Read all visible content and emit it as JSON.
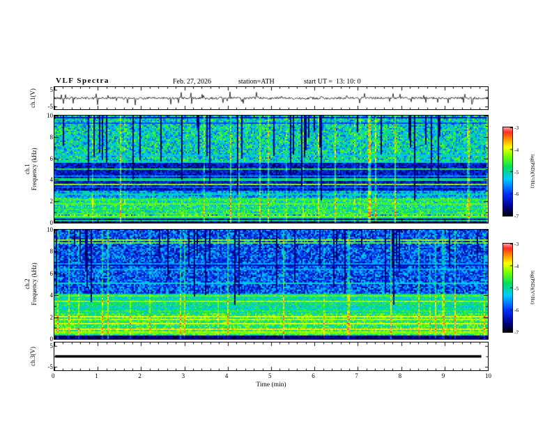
{
  "title": "VLF Spectra",
  "header": {
    "date": "Feb. 27, 2026",
    "station": "station=ATH",
    "start_ut": "start UT =  13: 10: 0"
  },
  "xaxis": {
    "label": "Time (min)",
    "range": [
      0,
      10
    ],
    "ticks": [
      0,
      1,
      2,
      3,
      4,
      5,
      6,
      7,
      8,
      9,
      10
    ]
  },
  "colorbar": {
    "label": "log(PSD)(V²/Hz)",
    "range": [
      -7,
      -3
    ],
    "ticks": [
      -3,
      -4,
      -5,
      -6,
      -7
    ],
    "stops": [
      [
        0.0,
        "#000000"
      ],
      [
        0.1,
        "#000080"
      ],
      [
        0.25,
        "#0030ff"
      ],
      [
        0.42,
        "#00ccff"
      ],
      [
        0.55,
        "#00dd66"
      ],
      [
        0.68,
        "#7aff00"
      ],
      [
        0.78,
        "#ffff00"
      ],
      [
        0.88,
        "#ff8800"
      ],
      [
        0.95,
        "#ff2a2a"
      ],
      [
        1.0,
        "#ff9999"
      ]
    ]
  },
  "chart_data": [
    {
      "type": "line",
      "name": "ch1-waveform",
      "ylabel": "ch.1(V)",
      "ylim": [
        -5,
        5
      ],
      "yticks": [
        5,
        -5
      ],
      "yscale_v": 6.5,
      "seed": 42,
      "noise_amp_v": 0.7,
      "spike_probability": 0.06,
      "spike_amp_v": 3.6,
      "description": "continuous noisy voltage trace near 0 V with frequent impulsive spikes"
    },
    {
      "type": "heatmap",
      "name": "ch1-spectrogram",
      "ylabel_line1": "ch.1",
      "ylabel_line2": "Frequency (kHz)",
      "ylim": [
        0,
        10
      ],
      "yticks": [
        0,
        2,
        4,
        6,
        8,
        10
      ],
      "value_range": [
        -7,
        -3
      ],
      "seed": 12345,
      "base_level": -5.0,
      "bands": [
        {
          "f0": 0.0,
          "f1": 0.35,
          "level": -6.5,
          "noise": 0.4
        },
        {
          "f0": 0.35,
          "f1": 0.9,
          "level": -5.0,
          "noise": 1.1
        },
        {
          "f0": 0.9,
          "f1": 2.3,
          "level": -4.9,
          "noise": 0.7
        },
        {
          "f0": 2.3,
          "f1": 3.0,
          "level": -5.5,
          "noise": 0.6
        },
        {
          "f0": 3.0,
          "f1": 5.6,
          "level": -6.3,
          "noise": 0.5
        },
        {
          "f0": 5.6,
          "f1": 10.0,
          "level": -5.1,
          "noise": 0.8
        }
      ],
      "hlines": [
        {
          "f": 0.5,
          "level": -4.3
        },
        {
          "f": 0.75,
          "level": -4.5
        },
        {
          "f": 1.2,
          "level": -4.6
        },
        {
          "f": 1.7,
          "level": -4.4
        },
        {
          "f": 2.1,
          "level": -4.5
        },
        {
          "f": 2.6,
          "level": -5.0
        },
        {
          "f": 3.3,
          "level": -5.8
        },
        {
          "f": 3.9,
          "level": -4.9
        },
        {
          "f": 4.4,
          "level": -5.6
        },
        {
          "f": 5.0,
          "level": -4.7
        },
        {
          "f": 6.3,
          "level": -5.3
        }
      ],
      "random_hline_probability": 0.1,
      "vstripes": {
        "probability": 0.09,
        "min_depth_khz": 1.2,
        "level": -6.9
      },
      "vbright": {
        "probability": 0.06,
        "boost": 0.7
      },
      "description": "dense speckled spectrogram, green/cyan background, dark blue band 3.0-5.6 kHz, many black vertical dropout stripes and bright horizontal lines"
    },
    {
      "type": "heatmap",
      "name": "ch2-spectrogram",
      "ylabel_line1": "ch.2",
      "ylabel_line2": "Frequency (kHz)",
      "ylim": [
        0,
        10
      ],
      "yticks": [
        0,
        2,
        4,
        6,
        8,
        10
      ],
      "value_range": [
        -7,
        -3
      ],
      "seed": 777,
      "base_level": -5.5,
      "bands": [
        {
          "f0": 0.0,
          "f1": 0.3,
          "level": -6.6,
          "noise": 0.3
        },
        {
          "f0": 0.3,
          "f1": 2.4,
          "level": -4.7,
          "noise": 0.6
        },
        {
          "f0": 2.4,
          "f1": 4.2,
          "level": -5.0,
          "noise": 0.5
        },
        {
          "f0": 4.2,
          "f1": 10.0,
          "level": -5.9,
          "noise": 0.7
        }
      ],
      "hlines": [
        {
          "f": 0.6,
          "level": -4.2
        },
        {
          "f": 0.95,
          "level": -3.8
        },
        {
          "f": 1.35,
          "level": -3.9
        },
        {
          "f": 1.8,
          "level": -4.1
        },
        {
          "f": 2.1,
          "level": -3.9
        },
        {
          "f": 2.6,
          "level": -4.6
        },
        {
          "f": 3.2,
          "level": -4.7
        },
        {
          "f": 4.0,
          "level": -4.4
        },
        {
          "f": 5.1,
          "level": -5.2
        },
        {
          "f": 6.4,
          "level": -5.5
        }
      ],
      "random_hline_probability": 0.08,
      "vstripes": {
        "probability": 0.09,
        "min_depth_khz": 3.0,
        "level": -6.9
      },
      "vbright": {
        "probability": 0.05,
        "boost": 0.6
      },
      "description": "spectrogram: green/yellow below ~4 kHz with bright yellow horizontal lines near 1-2 kHz, blue above 4 kHz, black vertical dropout stripes"
    },
    {
      "type": "line",
      "name": "ch3-flatline",
      "ylabel": "ch.3(V)",
      "ylim": [
        -5,
        5
      ],
      "yticks": [
        5,
        -5
      ],
      "yscale_v": 6.5,
      "constant_value_v": 0,
      "description": "flat thick black line at 0 V (no signal on channel 3)"
    }
  ]
}
